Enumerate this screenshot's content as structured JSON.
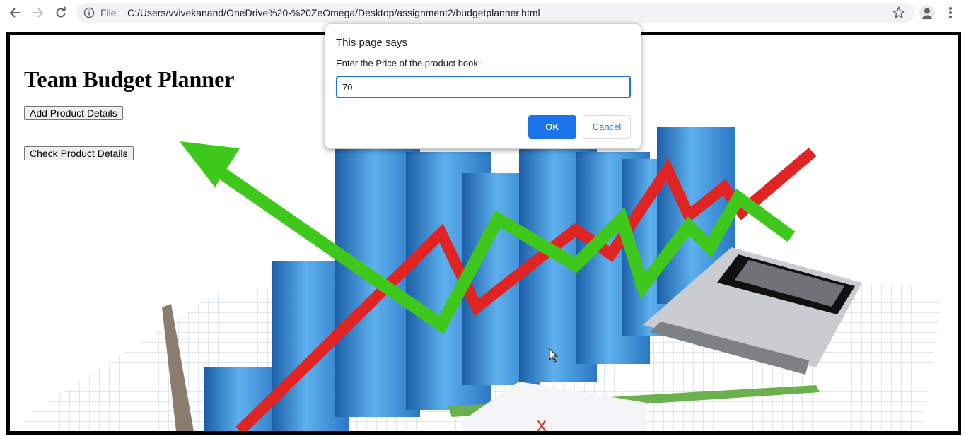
{
  "browser": {
    "scheme_label": "File",
    "url": "C:/Users/vvivekanand/OneDrive%20-%20ZeOmega/Desktop/assignment2/budgetplanner.html",
    "icons": [
      "back-arrow-icon",
      "forward-arrow-icon",
      "reload-icon",
      "info-icon",
      "star-icon",
      "profile-avatar-icon",
      "kebab-menu-icon"
    ]
  },
  "page": {
    "title": "Team Budget Planner",
    "buttons": {
      "add": "Add Product Details",
      "check": "Check Product Details"
    }
  },
  "dialog": {
    "title": "This page says",
    "message": "Enter the Price of the product book :",
    "input_value": "70",
    "ok_label": "OK",
    "cancel_label": "Cancel"
  },
  "colors": {
    "accent": "#1a73e8",
    "arrow_green": "#3ec81c",
    "arrow_red": "#e02424",
    "bar_blue": "#3a8ad6"
  }
}
